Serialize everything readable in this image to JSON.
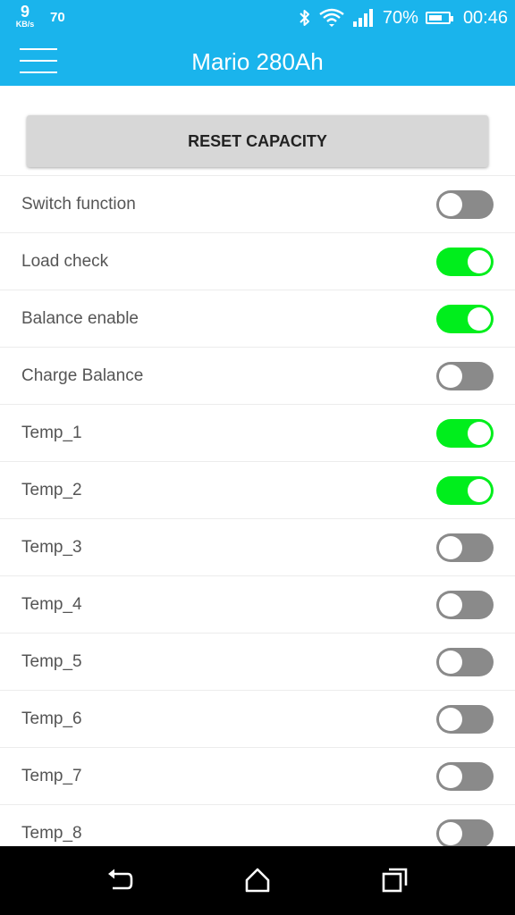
{
  "status_bar": {
    "net_speed": "9",
    "net_speed_unit": "KB/s",
    "notification": "70",
    "icons": [
      "bluetooth-icon",
      "wifi-icon",
      "signal-icon"
    ],
    "battery_text": "70%",
    "battery_level": 0.7,
    "time": "00:46"
  },
  "app_bar": {
    "menu_icon": "hamburger-menu-icon",
    "title": "Mario 280Ah"
  },
  "reset_button": {
    "label": "RESET CAPACITY"
  },
  "toggles": [
    {
      "label": "Switch function",
      "on": false
    },
    {
      "label": "Load check",
      "on": true
    },
    {
      "label": "Balance enable",
      "on": true
    },
    {
      "label": "Charge Balance",
      "on": false
    },
    {
      "label": "Temp_1",
      "on": true
    },
    {
      "label": "Temp_2",
      "on": true
    },
    {
      "label": "Temp_3",
      "on": false
    },
    {
      "label": "Temp_4",
      "on": false
    },
    {
      "label": "Temp_5",
      "on": false
    },
    {
      "label": "Temp_6",
      "on": false
    },
    {
      "label": "Temp_7",
      "on": false
    },
    {
      "label": "Temp_8",
      "on": false
    }
  ],
  "colors": {
    "accent": "#1ab4ec",
    "switch_on": "#00ee1c",
    "switch_off": "#8a8a8a"
  },
  "nav_bar": {
    "icons": [
      "back-icon",
      "home-icon",
      "recents-icon"
    ]
  }
}
